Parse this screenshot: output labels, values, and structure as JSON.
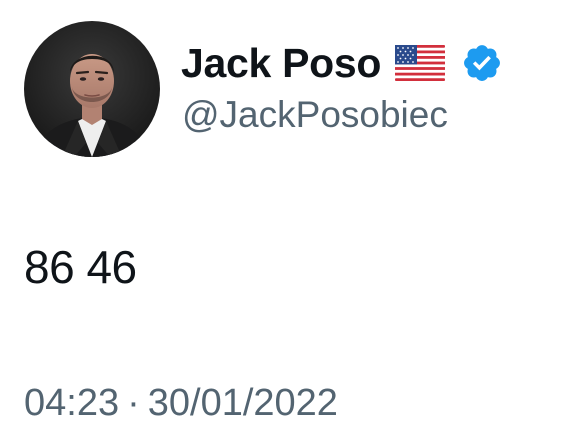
{
  "user": {
    "display_name": "Jack Poso",
    "handle": "@JackPosobiec",
    "flag_icon": "us-flag-emoji",
    "verified_icon": "verified-badge-icon",
    "verified_color": "#1d9bf0"
  },
  "tweet": {
    "text": "86 46",
    "time": "04:23",
    "separator": "·",
    "date": "30/01/2022"
  },
  "colors": {
    "text_primary": "#0f1419",
    "text_secondary": "#536471",
    "background": "#ffffff"
  }
}
